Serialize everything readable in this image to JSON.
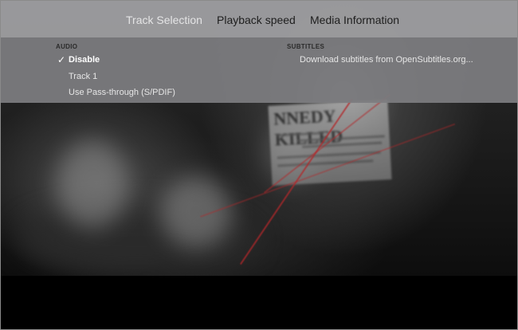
{
  "tabs": [
    {
      "label": "Track Selection",
      "selected": true
    },
    {
      "label": "Playback speed",
      "selected": false
    },
    {
      "label": "Media Information",
      "selected": false
    }
  ],
  "audio": {
    "header": "AUDIO",
    "options": [
      {
        "label": "Disable",
        "selected": true
      },
      {
        "label": "Track 1",
        "selected": false
      },
      {
        "label": "Use Pass-through (S/PDIF)",
        "selected": false
      }
    ],
    "check_glyph": "✓"
  },
  "subtitles": {
    "header": "SUBTITLES",
    "options": [
      {
        "label": "Download subtitles from OpenSubtitles.org...",
        "selected": false
      }
    ]
  },
  "video_frame": {
    "headline_text": "NNEDY KILLED"
  },
  "colors": {
    "panel": "#7d7d80",
    "tab_selected": "#f2f2f2",
    "tab_normal": "#1e1e1e",
    "accent_red": "#b3272a"
  }
}
